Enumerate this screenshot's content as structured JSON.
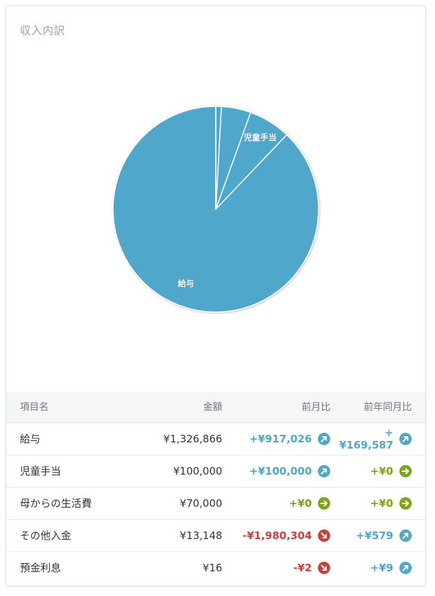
{
  "panel": {
    "title": "収入内訳"
  },
  "chart_data": {
    "type": "pie",
    "labels": [
      "給与",
      "児童手当",
      "母からの生活費",
      "その他入金",
      "預金利息"
    ],
    "values": [
      1326866,
      100000,
      70000,
      13148,
      16
    ],
    "slice_labels_shown": [
      "給与",
      "児童手当"
    ],
    "colors": [
      "#4fa8cb",
      "#4fa8cb",
      "#4fa8cb",
      "#4fa8cb",
      "#4fa8cb"
    ]
  },
  "table": {
    "headers": {
      "name": "項目名",
      "amount": "金額",
      "mom": "前月比",
      "yoy": "前年同月比"
    },
    "rows": [
      {
        "name": "給与",
        "amount": "¥1,326,866",
        "mom": "+¥917,026",
        "mom_trend": "up",
        "yoy": "+¥169,587",
        "yoy_trend": "up"
      },
      {
        "name": "児童手当",
        "amount": "¥100,000",
        "mom": "+¥100,000",
        "mom_trend": "up",
        "yoy": "+¥0",
        "yoy_trend": "flat"
      },
      {
        "name": "母からの生活費",
        "amount": "¥70,000",
        "mom": "+¥0",
        "mom_trend": "flat",
        "yoy": "+¥0",
        "yoy_trend": "flat"
      },
      {
        "name": "その他入金",
        "amount": "¥13,148",
        "mom": "-¥1,980,304",
        "mom_trend": "down",
        "yoy": "+¥579",
        "yoy_trend": "up"
      },
      {
        "name": "預金利息",
        "amount": "¥16",
        "mom": "-¥2",
        "mom_trend": "down",
        "yoy": "+¥9",
        "yoy_trend": "up"
      }
    ]
  },
  "trend_icons": {
    "up": "arrow-up-right-icon",
    "flat": "arrow-right-icon",
    "down": "arrow-down-right-icon"
  }
}
